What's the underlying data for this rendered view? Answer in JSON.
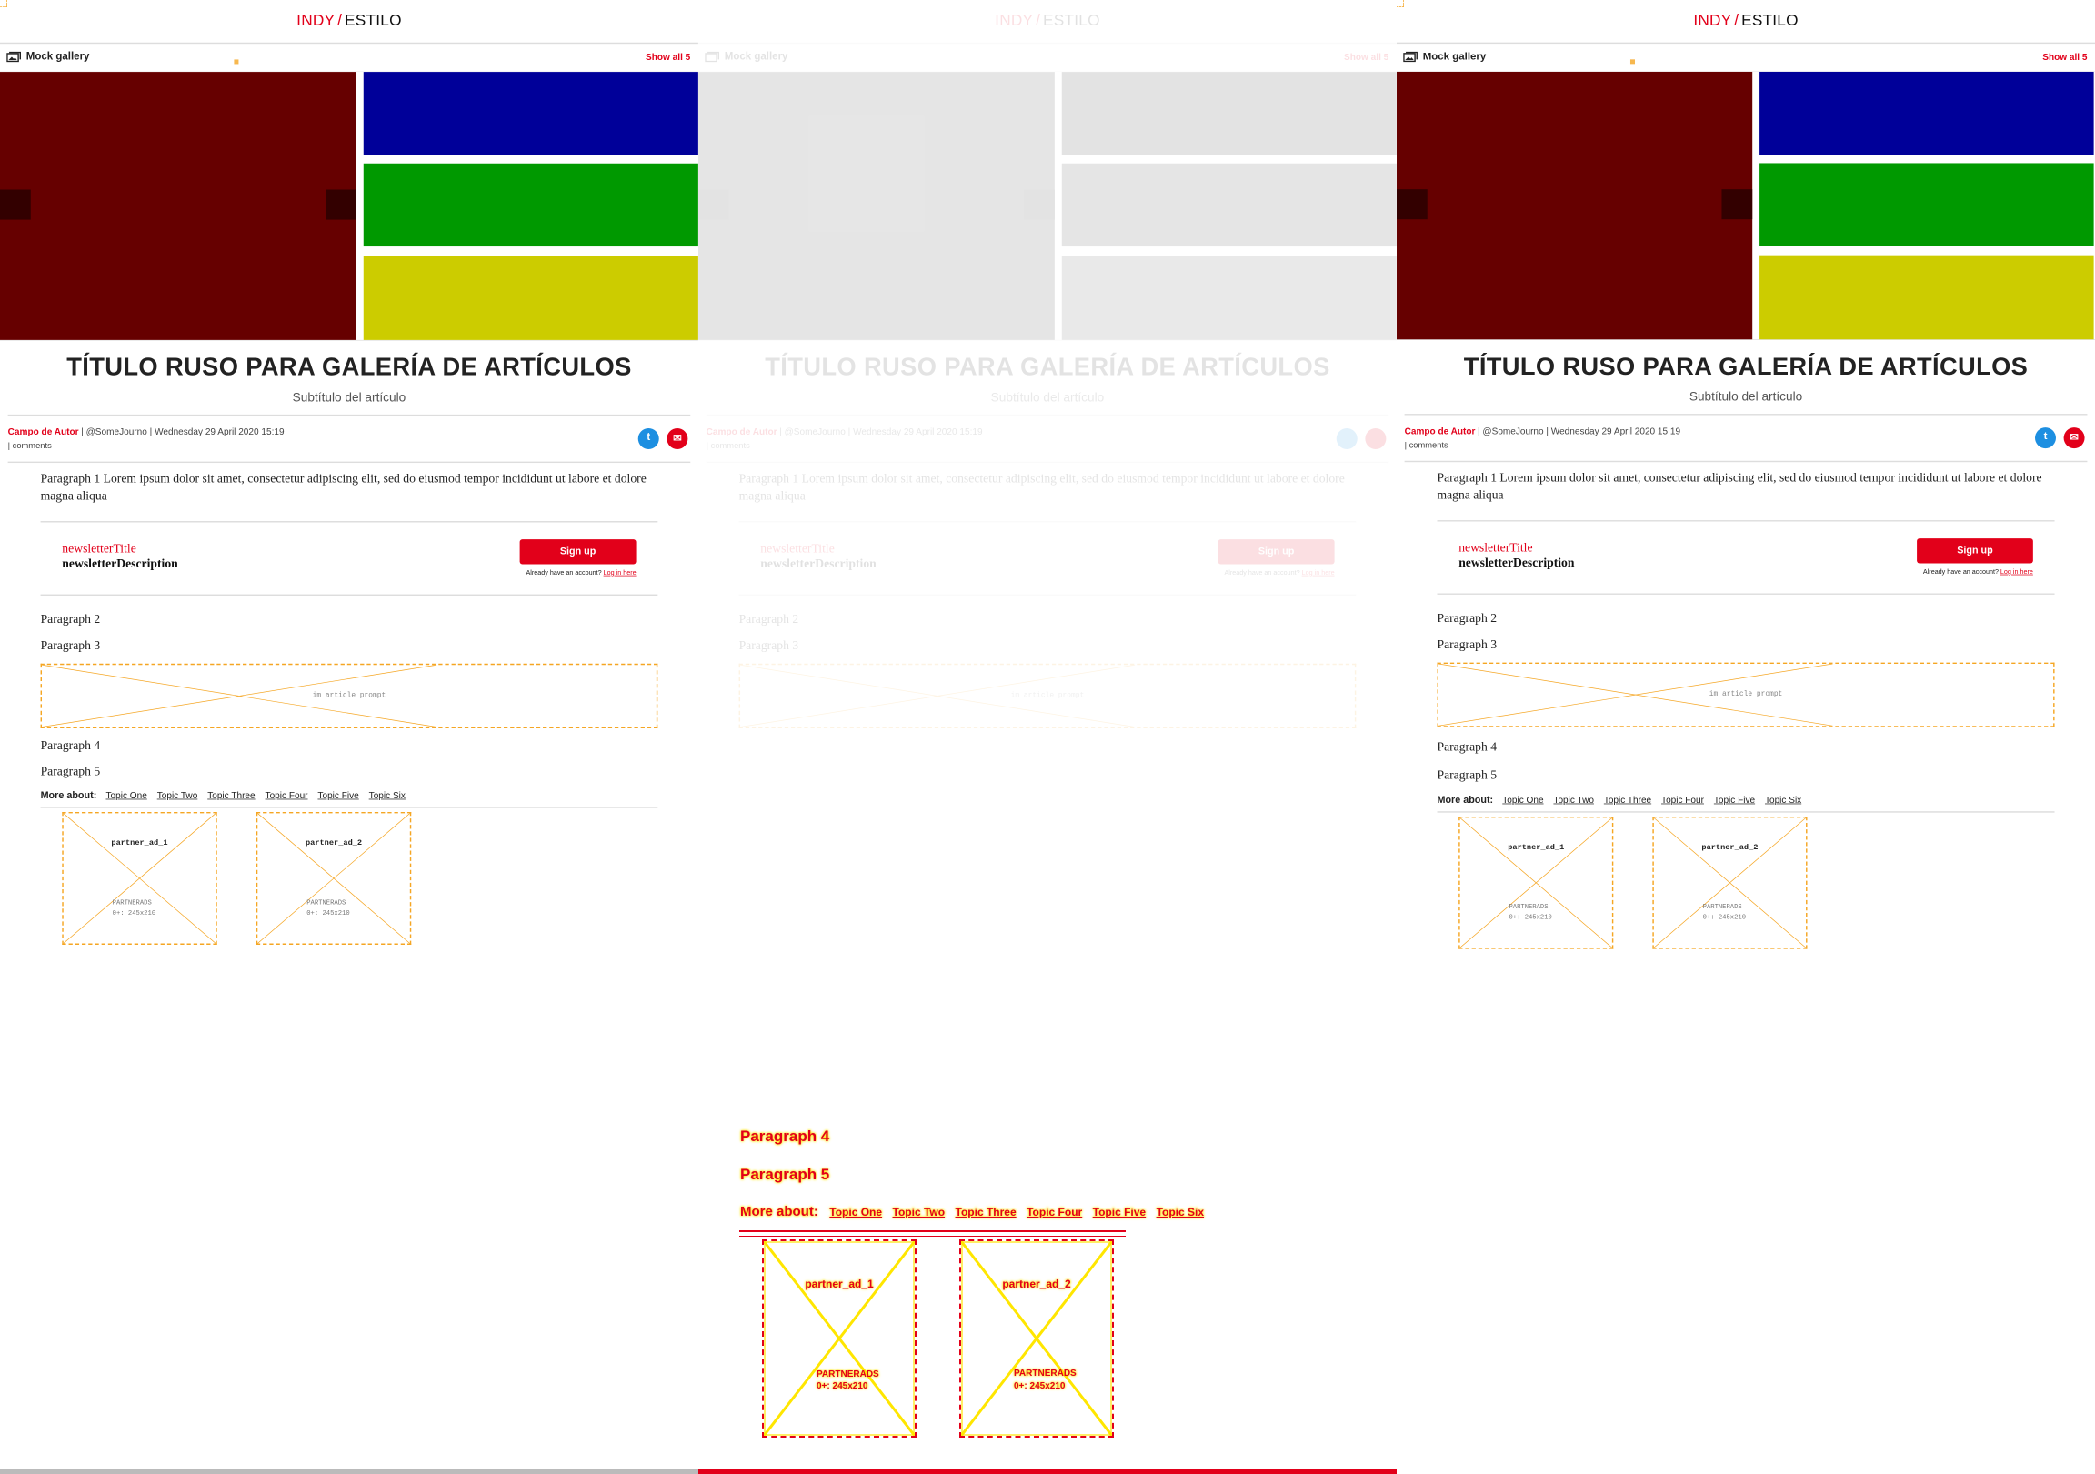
{
  "brand": {
    "part1": "INDY",
    "separator": "/",
    "part2": "ESTILO"
  },
  "gallery": {
    "icon": "gallery-icon",
    "title": "Mock gallery",
    "show_all": "Show all 5",
    "colors": [
      "#660000",
      "#000099",
      "#009900",
      "#cccc00"
    ]
  },
  "article": {
    "headline": "TÍTULO RUSO PARA GALERÍA DE ARTÍCULOS",
    "subtitle": "Subtítulo del artículo",
    "author": "Campo de Autor",
    "meta_rest": "| @SomeJourno | Wednesday 29 April 2020 15:19",
    "comments": "|  comments",
    "share_icons": [
      "twitter-icon",
      "email-icon"
    ],
    "paragraph1": "Paragraph 1 Lorem ipsum dolor sit amet, consectetur adipiscing elit, sed do eiusmod tempor incididunt ut labore et dolore magna aliqua",
    "paragraph2": "Paragraph 2",
    "paragraph3": "Paragraph 3",
    "paragraph4": "Paragraph 4",
    "paragraph5": "Paragraph 5"
  },
  "newsletter": {
    "title": "newsletterTitle",
    "description": "newsletterDescription",
    "signup": "Sign up",
    "login_prefix": "Already have an account?",
    "login_link": "Log in here"
  },
  "prompt": {
    "label": "im article prompt"
  },
  "topics": {
    "label": "More about:",
    "items": [
      "Topic One",
      "Topic Two",
      "Topic Three",
      "Topic Four",
      "Topic Five",
      "Topic Six"
    ]
  },
  "ads": [
    {
      "name": "partner_ad_1",
      "provider": "PARTNERADS",
      "size": "0+: 245x210"
    },
    {
      "name": "partner_ad_2",
      "provider": "PARTNERADS",
      "size": "0+: 245x210"
    }
  ],
  "colors": {
    "accent": "#e2001a",
    "dashed": "#f5a623",
    "highlight": "#ffe600"
  }
}
